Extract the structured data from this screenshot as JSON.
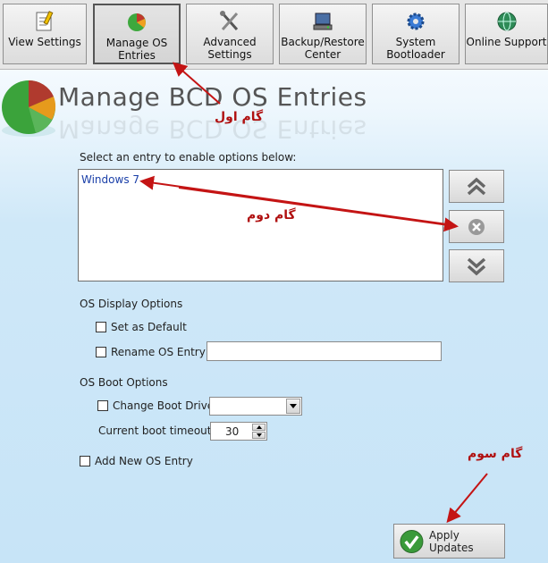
{
  "toolbar": {
    "buttons": [
      {
        "label": "View Settings",
        "icon": "notepad-icon"
      },
      {
        "label": "Manage OS\nEntries",
        "icon": "os-pie-icon"
      },
      {
        "label": "Advanced\nSettings",
        "icon": "tools-icon"
      },
      {
        "label": "Backup/Restore\nCenter",
        "icon": "backup-icon"
      },
      {
        "label": "System\nBootloader",
        "icon": "gear-icon"
      },
      {
        "label": "Online Support",
        "icon": "globe-icon"
      }
    ]
  },
  "header": {
    "title": "Manage BCD OS Entries"
  },
  "entries": {
    "prompt": "Select an entry to enable options below:",
    "items": [
      "Windows 7"
    ]
  },
  "display_options": {
    "heading": "OS Display Options",
    "set_default": "Set as Default",
    "rename": "Rename OS Entry",
    "rename_value": ""
  },
  "boot_options": {
    "heading": "OS Boot Options",
    "change_drive": "Change Boot Drive",
    "drive_value": "",
    "timeout_label": "Current boot timeout:",
    "timeout_value": "30"
  },
  "add_entry": "Add New OS Entry",
  "apply": "Apply Updates",
  "annotations": {
    "step1": "گام اول",
    "step2": "گام دوم",
    "step3": "گام سوم"
  },
  "colors": {
    "annotation": "#b01010",
    "background": "#cfe8f8"
  }
}
